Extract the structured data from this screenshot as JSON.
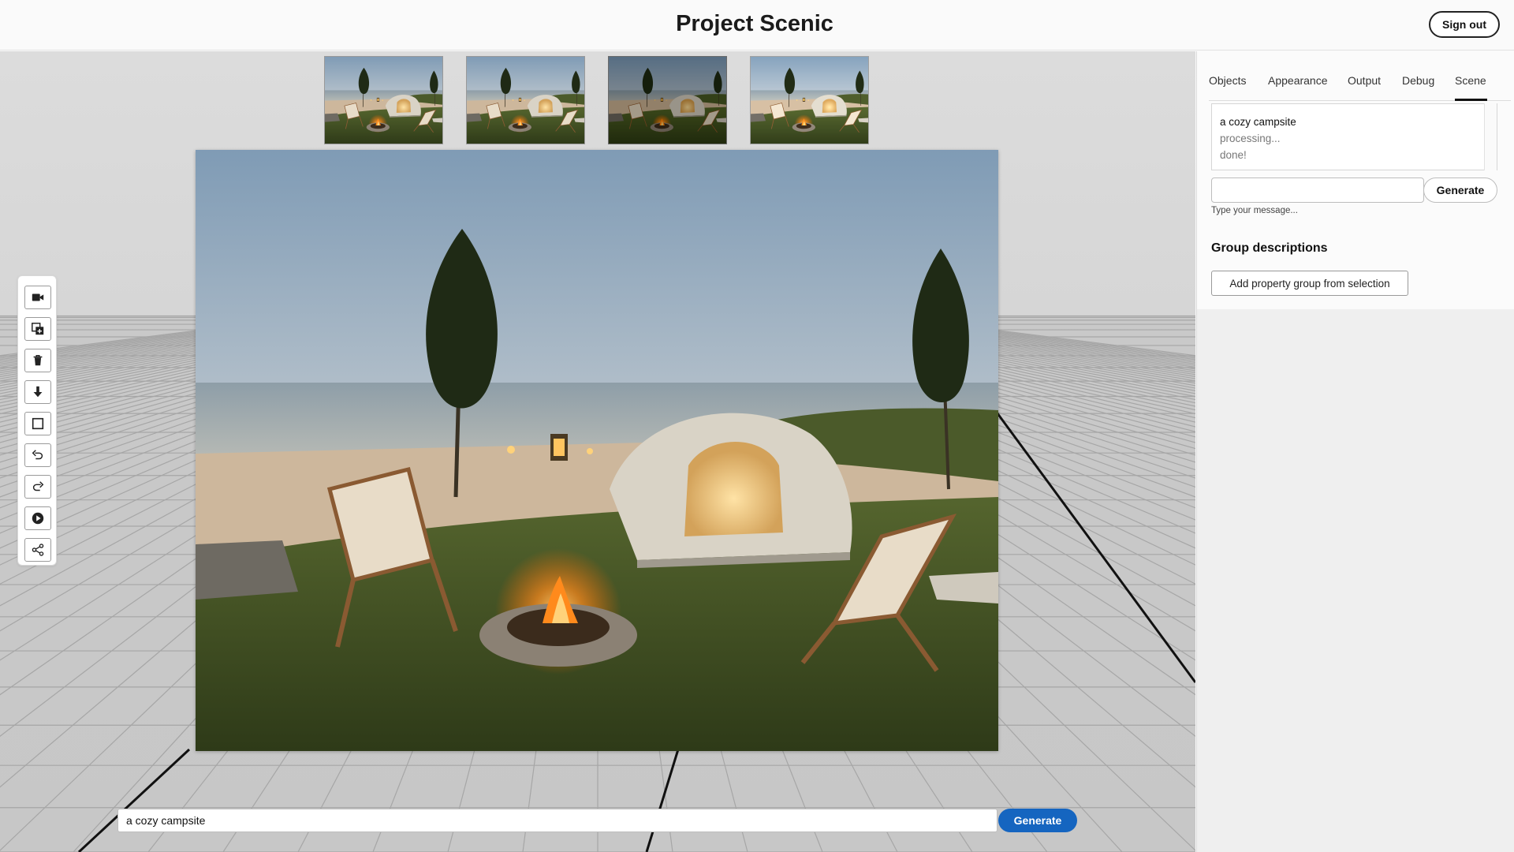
{
  "header": {
    "title": "Project Scenic",
    "sign_out_label": "Sign out"
  },
  "thumbnails": [
    {
      "name": "variation-1"
    },
    {
      "name": "variation-2"
    },
    {
      "name": "variation-3"
    },
    {
      "name": "variation-4"
    }
  ],
  "toolbar": {
    "tools": [
      "camera-icon",
      "duplicate-icon",
      "trash-icon",
      "drop-to-floor-icon",
      "bounding-box-icon",
      "undo-icon",
      "redo-icon",
      "play-icon",
      "share-icon"
    ]
  },
  "prompt": {
    "value": "a cozy campsite",
    "generate_label": "Generate"
  },
  "panel": {
    "tabs": [
      "Objects",
      "Appearance",
      "Output",
      "Debug",
      "Scene"
    ],
    "active_tab": "Scene",
    "log": [
      "a cozy campsite",
      "processing...",
      "done!"
    ],
    "chat": {
      "value": "",
      "generate_label": "Generate",
      "hint": "Type your message..."
    },
    "group_descriptions_title": "Group descriptions",
    "add_group_label": "Add property group from selection"
  },
  "colors": {
    "accent": "#1565c0",
    "panel_bg": "#efefef",
    "header_bg": "#fafafa"
  }
}
